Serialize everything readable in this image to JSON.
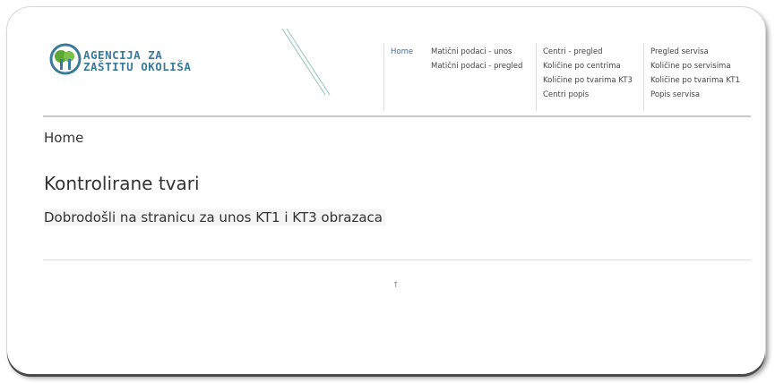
{
  "brand": {
    "line1": "AGENCIJA ZA",
    "line2": "ZAŠTITU OKOLIŠA",
    "color": "#3a7a9a",
    "leaf_color": "#5aa832"
  },
  "nav": {
    "home": "Home",
    "col1": [
      "Matični podaci - unos",
      "Matični podaci - pregled"
    ],
    "col2": [
      "Centri - pregled",
      "Količine po centrima",
      "Količine po tvarima KT3",
      "Centri popis"
    ],
    "col3": [
      "Pregled servisa",
      "Količine po servisima",
      "Količine po tvarima KT1",
      "Popis servisa"
    ]
  },
  "breadcrumb": "Home",
  "page_title": "Kontrolirane tvari",
  "welcome": "Dobrodošli na stranicu za unos KT1 i KT3 obrazaca",
  "footer_mark": "↑"
}
